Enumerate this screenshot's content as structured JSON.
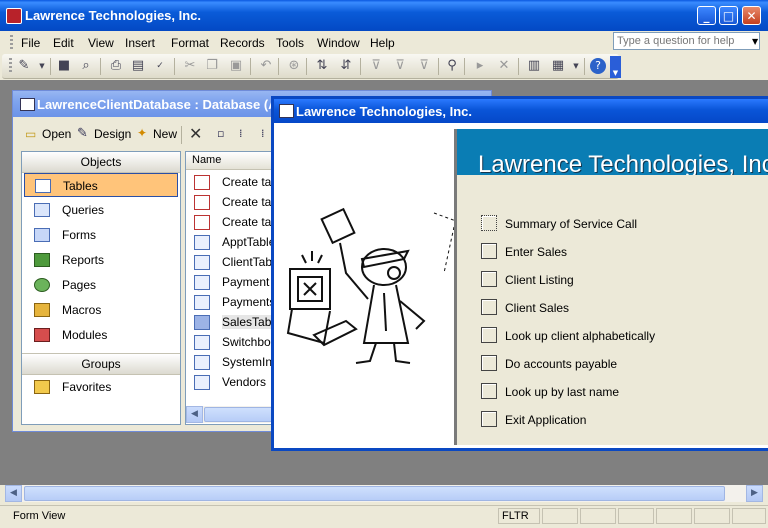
{
  "app": {
    "title": "Lawrence Technologies, Inc."
  },
  "menu": [
    "File",
    "Edit",
    "View",
    "Insert",
    "Format",
    "Records",
    "Tools",
    "Window",
    "Help"
  ],
  "help_box": {
    "placeholder": "Type a question for help"
  },
  "db_window": {
    "title": "LawrenceClientDatabase : Database (A",
    "toolbar": {
      "open": "Open",
      "design": "Design",
      "new": "New"
    },
    "objects_header": "Objects",
    "objects": [
      "Tables",
      "Queries",
      "Forms",
      "Reports",
      "Pages",
      "Macros",
      "Modules"
    ],
    "selected_object": "Tables",
    "groups_header": "Groups",
    "groups": [
      "Favorites"
    ],
    "list_header": "Name",
    "list_items": [
      "Create tab",
      "Create tab",
      "Create tab",
      "ApptTable",
      "ClientTable",
      "Payment c",
      "Payments",
      "SalesTable",
      "Switchboa",
      "SystemInf",
      "Vendors"
    ]
  },
  "switchboard": {
    "window_title": "Lawrence Technologies, Inc.",
    "heading": "Lawrence Technologies, Inc",
    "items": [
      "Summary of Service Call",
      "Enter Sales",
      "Client Listing",
      "Client Sales",
      "Look up client alphabetically",
      "Do accounts payable",
      "Look up by last name",
      "Exit Application"
    ]
  },
  "status": {
    "mode": "Form View",
    "filter": "FLTR"
  },
  "colors": {
    "xp_blue": "#0a55d8",
    "selection_orange": "#ffc47a",
    "header_teal": "#0a7db4"
  }
}
